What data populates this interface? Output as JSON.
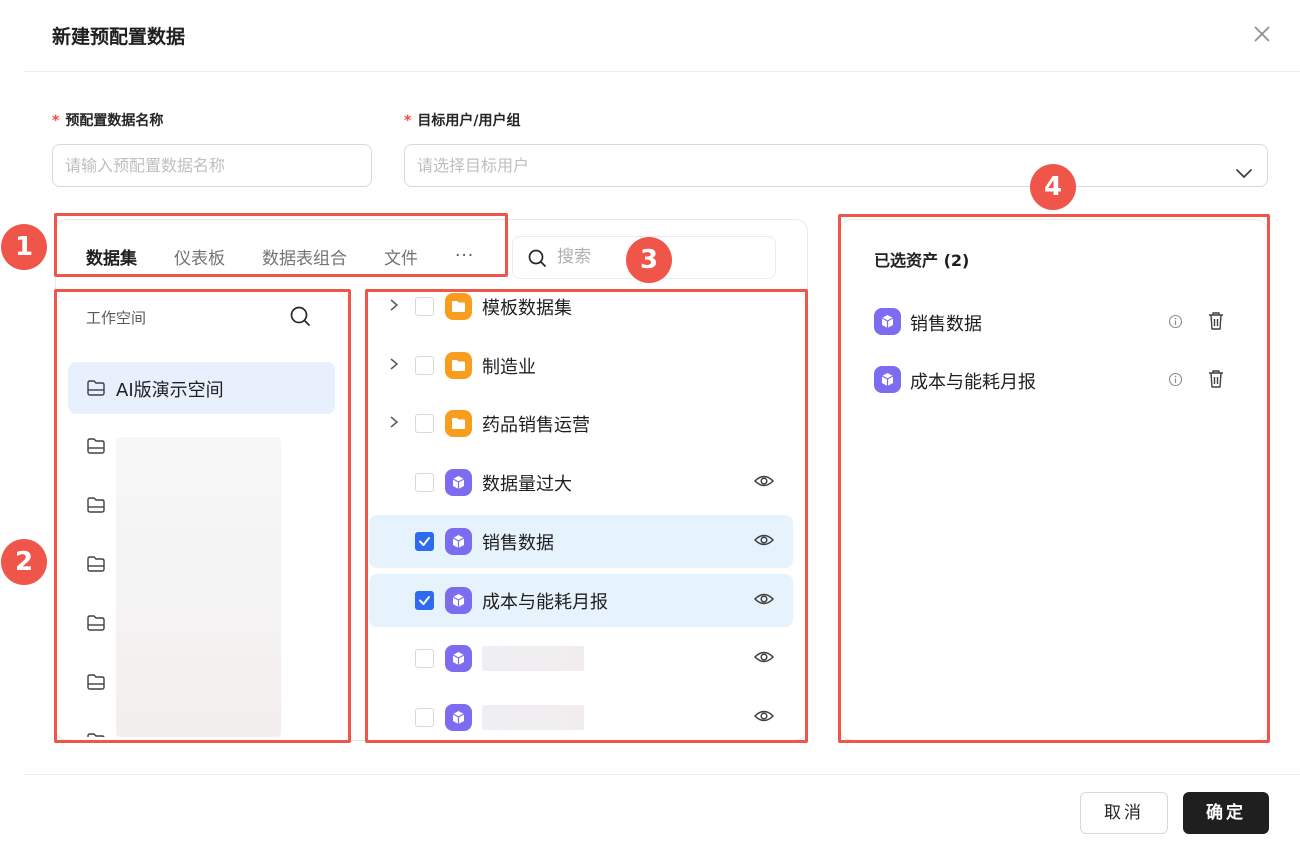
{
  "dialog": {
    "title": "新建预配置数据"
  },
  "form": {
    "name_label": "预配置数据名称",
    "name_placeholder": "请输入预配置数据名称",
    "target_label": "目标用户/用户组",
    "target_placeholder": "请选择目标用户",
    "required_mark": "*"
  },
  "tabs": [
    "数据集",
    "仪表板",
    "数据表组合",
    "文件"
  ],
  "tabs_more": "···",
  "search": {
    "placeholder": "搜索"
  },
  "workspace": {
    "title": "工作空间",
    "selected_item": "AI版演示空间"
  },
  "assets": [
    {
      "label": "模板数据集",
      "type": "folder",
      "checked": false,
      "expandable": true
    },
    {
      "label": "制造业",
      "type": "folder",
      "checked": false,
      "expandable": true
    },
    {
      "label": "药品销售运营",
      "type": "folder",
      "checked": false,
      "expandable": true
    },
    {
      "label": "数据量过大",
      "type": "dataset",
      "checked": false,
      "expandable": false
    },
    {
      "label": "销售数据",
      "type": "dataset",
      "checked": true,
      "expandable": false
    },
    {
      "label": "成本与能耗月报",
      "type": "dataset",
      "checked": true,
      "expandable": false
    }
  ],
  "selected_assets": {
    "title": "已选资产 (2)",
    "items": [
      "销售数据",
      "成本与能耗月报"
    ]
  },
  "markers": [
    "1",
    "2",
    "3",
    "4"
  ],
  "footer": {
    "cancel": "取消",
    "confirm": "确定"
  },
  "colors": {
    "annotation": "#f0554a",
    "primary_check": "#2f6bf0",
    "folder": "#f99d1f",
    "dataset": "#7b6cf0",
    "selected_row": "#e6f2fc"
  }
}
